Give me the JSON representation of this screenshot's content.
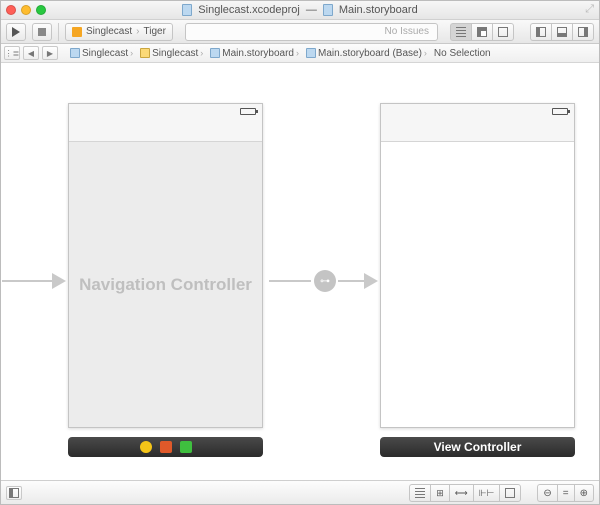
{
  "window": {
    "title_left": "Singlecast.xcodeproj",
    "title_sep": "—",
    "title_right": "Main.storyboard"
  },
  "toolbar": {
    "scheme_name": "Singlecast",
    "scheme_dest": "Tiger",
    "status": "No Issues"
  },
  "jumpbar": {
    "related": "⋮≣",
    "back": "◀",
    "forward": "▶",
    "crumbs": [
      "Singlecast",
      "Singlecast",
      "Main.storyboard",
      "Main.storyboard (Base)",
      "No Selection"
    ]
  },
  "canvas": {
    "nav_controller_label": "Navigation Controller",
    "view_controller_label": "View Controller",
    "segue_glyph": "⊶"
  },
  "icons": {
    "back_arrow": "yellow-circle-left",
    "first_responder": "orange-cube",
    "exit": "green-exit"
  }
}
